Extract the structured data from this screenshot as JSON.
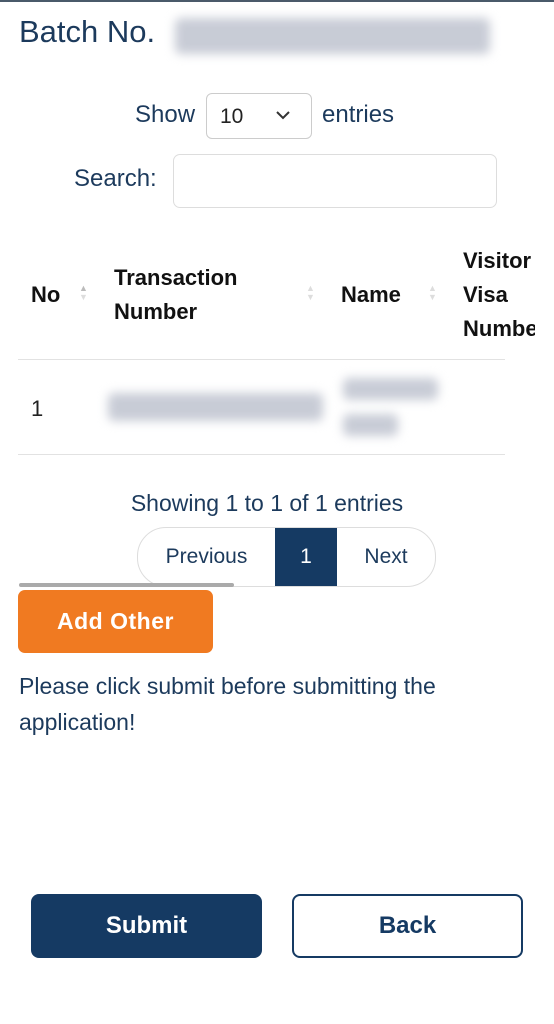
{
  "header": {
    "title": "Batch No."
  },
  "length": {
    "show_label": "Show",
    "value": "10",
    "entries_label": "entries"
  },
  "search": {
    "label": "Search:",
    "value": "",
    "placeholder": ""
  },
  "table": {
    "columns": [
      "No",
      "Transaction Number",
      "Name",
      "Visitor Visa Number"
    ],
    "rows": [
      {
        "no": "1"
      }
    ]
  },
  "info": "Showing 1 to 1 of 1 entries",
  "pagination": {
    "previous": "Previous",
    "current": "1",
    "next": "Next"
  },
  "add_other": "Add Other",
  "note": "Please click submit before submitting the application!",
  "actions": {
    "submit": "Submit",
    "back": "Back"
  },
  "colors": {
    "primary": "#153a63",
    "accent": "#f07a21"
  }
}
